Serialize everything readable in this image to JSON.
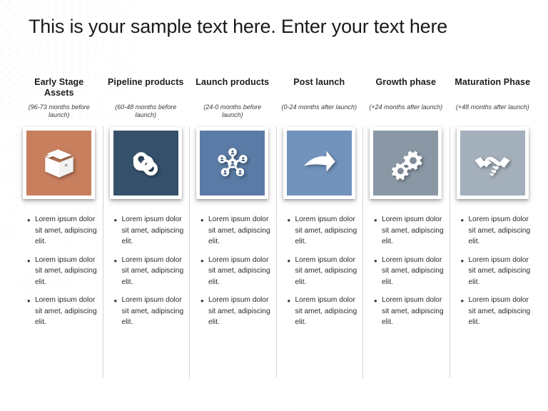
{
  "slide": {
    "title": "This is your sample text here. Enter your text here"
  },
  "columns": [
    {
      "title": "Early Stage Assets",
      "subtitle": "(96-73 months before launch)",
      "icon": "box-icon",
      "color": "#C87F5E",
      "bullets": [
        "Lorem ipsum dolor sit amet, adipiscing elit.",
        "Lorem ipsum dolor sit amet, adipiscing elit.",
        "Lorem ipsum dolor sit amet, adipiscing elit."
      ]
    },
    {
      "title": "Pipeline products",
      "subtitle": "(60-48 months before launch)",
      "icon": "chain-link-icon",
      "color": "#35506B",
      "bullets": [
        "Lorem ipsum dolor sit amet, adipiscing elit.",
        "Lorem ipsum dolor sit amet, adipiscing elit.",
        "Lorem ipsum dolor sit amet, adipiscing elit."
      ]
    },
    {
      "title": "Launch products",
      "subtitle": "(24-0 months before launch)",
      "icon": "network-hub-icon",
      "color": "#5A7BA5",
      "bullets": [
        "Lorem ipsum dolor sit amet, adipiscing elit.",
        "Lorem ipsum dolor sit amet, adipiscing elit.",
        "Lorem ipsum dolor sit amet, adipiscing elit."
      ]
    },
    {
      "title": "Post launch",
      "subtitle": "(0-24 months after launch)",
      "icon": "curved-arrow-right-icon",
      "color": "#7193BC",
      "bullets": [
        "Lorem ipsum dolor sit amet, adipiscing elit.",
        "Lorem ipsum dolor sit amet, adipiscing elit.",
        "Lorem ipsum dolor sit amet, adipiscing elit."
      ]
    },
    {
      "title": "Growth phase",
      "subtitle": "(+24 months after launch)",
      "icon": "gears-icon",
      "color": "#8A97A5",
      "bullets": [
        "Lorem ipsum dolor sit amet, adipiscing elit.",
        "Lorem ipsum dolor sit amet, adipiscing elit.",
        "Lorem ipsum dolor sit amet, adipiscing elit."
      ]
    },
    {
      "title": "Maturation Phase",
      "subtitle": "(+48 months after launch)",
      "icon": "handshake-icon",
      "color": "#A3AFBA",
      "bullets": [
        "Lorem ipsum dolor sit amet, adipiscing elit.",
        "Lorem ipsum dolor sit amet, adipiscing elit.",
        "Lorem ipsum dolor sit amet, adipiscing elit."
      ]
    }
  ],
  "bullet_marker": "•"
}
